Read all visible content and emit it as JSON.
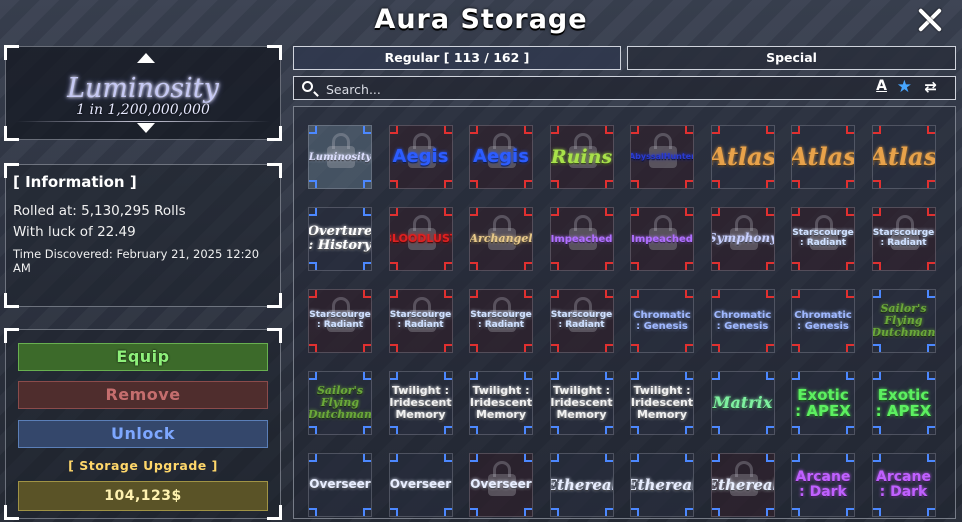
{
  "window": {
    "title": "Aura Storage",
    "close_icon": "close-icon"
  },
  "selected_aura": {
    "name": "Luminosity",
    "rarity": "1 in 1,200,000,000"
  },
  "information": {
    "header": "[ Information ]",
    "rolled_at": "Rolled at: 5,130,295 Rolls",
    "luck": "With luck of 22.49",
    "discovered": "Time Discovered: February 21, 2025 12:20 AM"
  },
  "actions": {
    "equip": "Equip",
    "remove": "Remove",
    "unlock": "Unlock",
    "storage_upgrade": "[ Storage Upgrade ]",
    "price": "104,123$"
  },
  "tabs": {
    "regular": "Regular [ 113 / 162 ]",
    "special": "Special"
  },
  "search": {
    "placeholder": "Search...",
    "sort_label": "A",
    "favorite_icon": "star-icon",
    "swap_icon": "swap-icon"
  },
  "colors": {
    "equip": "#8ef07a",
    "remove": "#c56e6e",
    "unlock": "#7da7ff",
    "storage": "#ffd76a",
    "favorite": "#47a6ff"
  },
  "auras": [
    {
      "label": "Luminosity",
      "color": "#dde0ff",
      "font": "serif",
      "size": 10,
      "locked": true,
      "selected": true,
      "corners": "#4c88ff"
    },
    {
      "label": "Aegis",
      "color": "#2c5cff",
      "font": "sans",
      "size": 18,
      "locked": true,
      "corners": "#e03030"
    },
    {
      "label": "Aegis",
      "color": "#2c5cff",
      "font": "sans",
      "size": 18,
      "locked": true,
      "corners": "#e03030"
    },
    {
      "label": "Ruins",
      "color": "#a8e14a",
      "font": "serif",
      "size": 19,
      "locked": true,
      "corners": "#e03030"
    },
    {
      "label": "AbyssalHunter",
      "color": "#2a3bd0",
      "font": "sans",
      "size": 8,
      "locked": true,
      "corners": "#e03030"
    },
    {
      "label": "Atlas",
      "color": "#e8a24a",
      "font": "serif",
      "size": 24,
      "locked": false,
      "corners": "#e03030"
    },
    {
      "label": "Atlas",
      "color": "#e8a24a",
      "font": "serif",
      "size": 24,
      "locked": false,
      "corners": "#e03030"
    },
    {
      "label": "Atlas",
      "color": "#e8a24a",
      "font": "serif",
      "size": 24,
      "locked": false,
      "corners": "#e03030"
    },
    {
      "label": "Overture : History",
      "color": "#ffffff",
      "font": "serif",
      "size": 13,
      "locked": false,
      "corners": "#4c88ff"
    },
    {
      "label": "BLOODLUST",
      "color": "#e02020",
      "font": "sans",
      "size": 11,
      "locked": true,
      "corners": "#e03030"
    },
    {
      "label": "Archangel",
      "color": "#e8c98a",
      "font": "serif",
      "size": 11,
      "locked": true,
      "corners": "#e03030"
    },
    {
      "label": "Impeached",
      "color": "#b070ff",
      "font": "sans",
      "size": 10,
      "locked": true,
      "corners": "#e03030"
    },
    {
      "label": "Impeached",
      "color": "#b070ff",
      "font": "sans",
      "size": 10,
      "locked": true,
      "corners": "#e03030"
    },
    {
      "label": "Symphony",
      "color": "#c8d0ff",
      "font": "serif",
      "size": 12,
      "locked": true,
      "corners": "#e03030"
    },
    {
      "label": "Starscourge : Radiant",
      "color": "#cfe0ff",
      "font": "sans",
      "size": 9,
      "locked": true,
      "corners": "#e03030"
    },
    {
      "label": "Starscourge : Radiant",
      "color": "#cfe0ff",
      "font": "sans",
      "size": 9,
      "locked": true,
      "corners": "#e03030"
    },
    {
      "label": "Starscourge : Radiant",
      "color": "#cfe0ff",
      "font": "sans",
      "size": 9,
      "locked": true,
      "corners": "#e03030"
    },
    {
      "label": "Starscourge : Radiant",
      "color": "#cfe0ff",
      "font": "sans",
      "size": 9,
      "locked": true,
      "corners": "#e03030"
    },
    {
      "label": "Starscourge : Radiant",
      "color": "#cfe0ff",
      "font": "sans",
      "size": 9,
      "locked": true,
      "corners": "#e03030"
    },
    {
      "label": "Starscourge : Radiant",
      "color": "#cfe0ff",
      "font": "sans",
      "size": 9,
      "locked": true,
      "corners": "#e03030"
    },
    {
      "label": "Chromatic : Genesis",
      "color": "#9fb8ff",
      "font": "sans",
      "size": 10,
      "locked": false,
      "corners": "#e03030"
    },
    {
      "label": "Chromatic : Genesis",
      "color": "#9fb8ff",
      "font": "sans",
      "size": 10,
      "locked": false,
      "corners": "#e03030"
    },
    {
      "label": "Chromatic : Genesis",
      "color": "#9fb8ff",
      "font": "sans",
      "size": 10,
      "locked": false,
      "corners": "#e03030"
    },
    {
      "label": "Sailor's Flying Dutchman",
      "color": "#6aa83a",
      "font": "serif",
      "size": 11,
      "locked": false,
      "corners": "#4c88ff"
    },
    {
      "label": "Sailor's Flying Dutchman",
      "color": "#6aa83a",
      "font": "serif",
      "size": 11,
      "locked": false,
      "corners": "#4c88ff"
    },
    {
      "label": "Twilight : Iridescent Memory",
      "color": "#f0f0f0",
      "font": "sans",
      "size": 11,
      "locked": false,
      "corners": "#4c88ff"
    },
    {
      "label": "Twilight : Iridescent Memory",
      "color": "#f0f0f0",
      "font": "sans",
      "size": 11,
      "locked": false,
      "corners": "#4c88ff"
    },
    {
      "label": "Twilight : Iridescent Memory",
      "color": "#f0f0f0",
      "font": "sans",
      "size": 11,
      "locked": false,
      "corners": "#4c88ff"
    },
    {
      "label": "Twilight : Iridescent Memory",
      "color": "#f0f0f0",
      "font": "sans",
      "size": 11,
      "locked": false,
      "corners": "#4c88ff"
    },
    {
      "label": "Matrix",
      "color": "#7ef0a0",
      "font": "serif",
      "size": 16,
      "locked": false,
      "corners": "#4c88ff"
    },
    {
      "label": "Exotic : APEX",
      "color": "#5cf060",
      "font": "sans",
      "size": 15,
      "locked": false,
      "corners": "#4c88ff"
    },
    {
      "label": "Exotic : APEX",
      "color": "#5cf060",
      "font": "sans",
      "size": 15,
      "locked": false,
      "corners": "#4c88ff"
    },
    {
      "label": "Overseer",
      "color": "#e8eeff",
      "font": "sans",
      "size": 12,
      "locked": false,
      "corners": "#4c88ff"
    },
    {
      "label": "Overseer",
      "color": "#e8eeff",
      "font": "sans",
      "size": 12,
      "locked": false,
      "corners": "#4c88ff"
    },
    {
      "label": "Overseer",
      "color": "#e8eeff",
      "font": "sans",
      "size": 12,
      "locked": true,
      "corners": "#4c88ff"
    },
    {
      "label": "Ethereal",
      "color": "#e8eeff",
      "font": "serif",
      "size": 15,
      "locked": false,
      "corners": "#4c88ff"
    },
    {
      "label": "Ethereal",
      "color": "#e8eeff",
      "font": "serif",
      "size": 15,
      "locked": false,
      "corners": "#4c88ff"
    },
    {
      "label": "Ethereal",
      "color": "#e8eeff",
      "font": "serif",
      "size": 15,
      "locked": true,
      "corners": "#4c88ff"
    },
    {
      "label": "Arcane : Dark",
      "color": "#c060ff",
      "font": "sans",
      "size": 14,
      "locked": false,
      "corners": "#4c88ff"
    },
    {
      "label": "Arcane : Dark",
      "color": "#c060ff",
      "font": "sans",
      "size": 14,
      "locked": false,
      "corners": "#4c88ff"
    }
  ]
}
